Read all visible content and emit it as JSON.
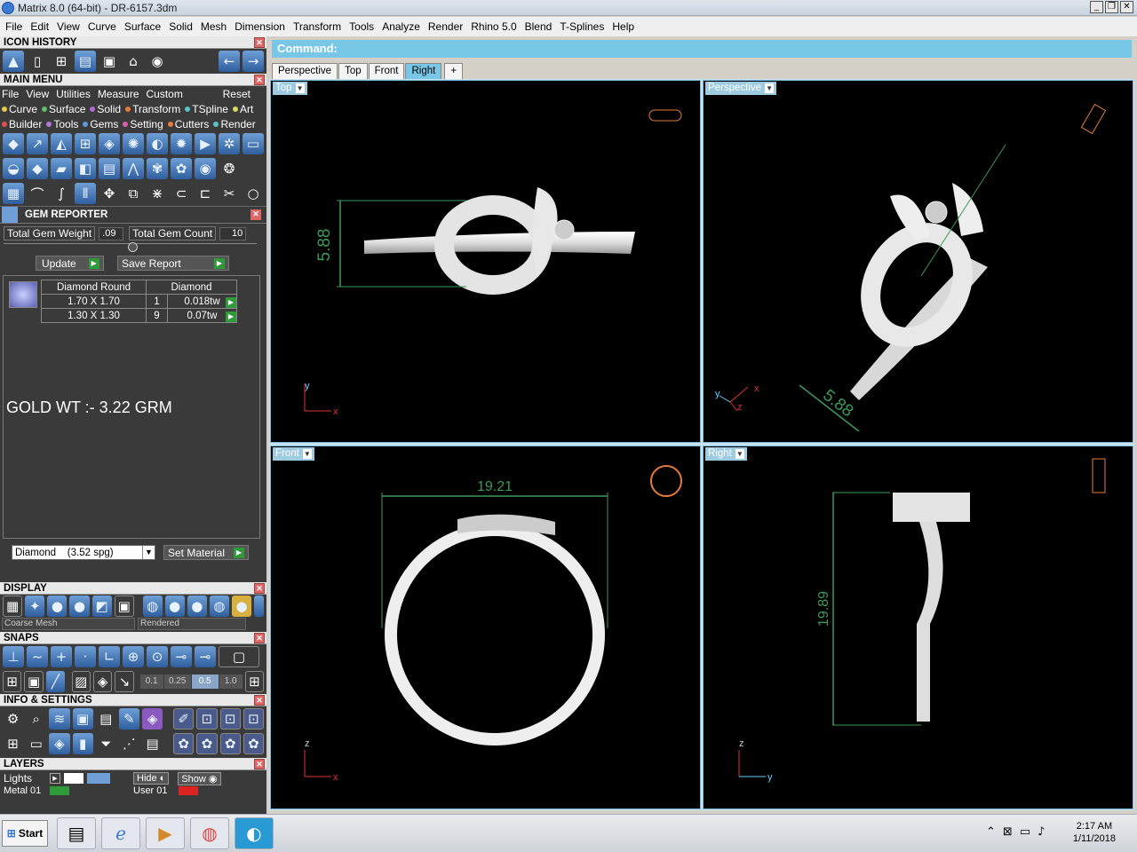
{
  "window": {
    "title": "Matrix 8.0 (64-bit) - DR-6157.3dm",
    "controls": [
      "_",
      "❐",
      "✕"
    ]
  },
  "menu": [
    "File",
    "Edit",
    "View",
    "Curve",
    "Surface",
    "Solid",
    "Mesh",
    "Dimension",
    "Transform",
    "Tools",
    "Analyze",
    "Render",
    "Rhino 5.0",
    "Blend",
    "T-Splines",
    "Help"
  ],
  "icon_history": {
    "title": "ICON HISTORY"
  },
  "main_menu": {
    "title": "MAIN MENU",
    "row1": [
      "File",
      "View",
      "Utilities",
      "Measure",
      "Custom"
    ],
    "reset": "Reset",
    "row2": [
      {
        "label": "Curve",
        "color": "#e8c84a"
      },
      {
        "label": "Surface",
        "color": "#5fc06a"
      },
      {
        "label": "Solid",
        "color": "#b36ad0"
      },
      {
        "label": "Transform",
        "color": "#e87a3a"
      },
      {
        "label": "TSpline",
        "color": "#5cc0c8"
      },
      {
        "label": "Art",
        "color": "#d8d86a"
      }
    ],
    "row3": [
      {
        "label": "Builder",
        "color": "#e05050"
      },
      {
        "label": "Tools",
        "color": "#b07ad0"
      },
      {
        "label": "Gems",
        "color": "#5c9ad8"
      },
      {
        "label": "Setting",
        "color": "#d860b0"
      },
      {
        "label": "Cutters",
        "color": "#e87a3a"
      },
      {
        "label": "Render",
        "color": "#5cc0c8"
      }
    ]
  },
  "gem_reporter": {
    "title": "GEM REPORTER",
    "total_weight_label": "Total Gem Weight",
    "total_weight_value": ".09",
    "total_count_label": "Total Gem Count",
    "total_count_value": "10",
    "update": "Update",
    "save_report": "Save Report",
    "table_header": [
      "Diamond Round",
      "Diamond"
    ],
    "rows": [
      {
        "size": "1.70 X 1.70",
        "count": "1",
        "weight": "0.018tw"
      },
      {
        "size": "1.30 X 1.30",
        "count": "9",
        "weight": "0.07tw"
      }
    ],
    "gold_note": "GOLD WT :- 3.22 GRM",
    "material": "Diamond    (3.52 spg)",
    "set_material": "Set Material"
  },
  "display": {
    "title": "DISPLAY",
    "mesh": "Coarse Mesh",
    "mode": "Rendered"
  },
  "snaps": {
    "title": "SNAPS",
    "values": [
      "0.1",
      "0.25",
      "0.5",
      "1.0"
    ]
  },
  "info_settings": {
    "title": "INFO & SETTINGS"
  },
  "layers": {
    "title": "LAYERS",
    "lights": "Lights",
    "hide": "Hide",
    "show": "Show",
    "metal": "Metal 01",
    "user": "User 01"
  },
  "command": {
    "label": "Command:"
  },
  "tabs": [
    {
      "label": "Perspective",
      "active": false
    },
    {
      "label": "Top",
      "active": false
    },
    {
      "label": "Front",
      "active": false
    },
    {
      "label": "Right",
      "active": true
    },
    {
      "label": "+",
      "active": false
    }
  ],
  "viewports": {
    "top": {
      "label": "Top",
      "dimension": "5.88",
      "axes": [
        "y",
        "x"
      ]
    },
    "perspective": {
      "label": "Perspective",
      "dimension": "5.88",
      "axes": [
        "y",
        "z",
        "x"
      ]
    },
    "front": {
      "label": "Front",
      "dimension": "19.21",
      "axes": [
        "z",
        "x"
      ]
    },
    "right": {
      "label": "Right",
      "dimension": "19.89",
      "axes": [
        "z",
        "y"
      ]
    }
  },
  "taskbar": {
    "start": "Start",
    "time": "2:17 AM",
    "date": "1/11/2018"
  }
}
